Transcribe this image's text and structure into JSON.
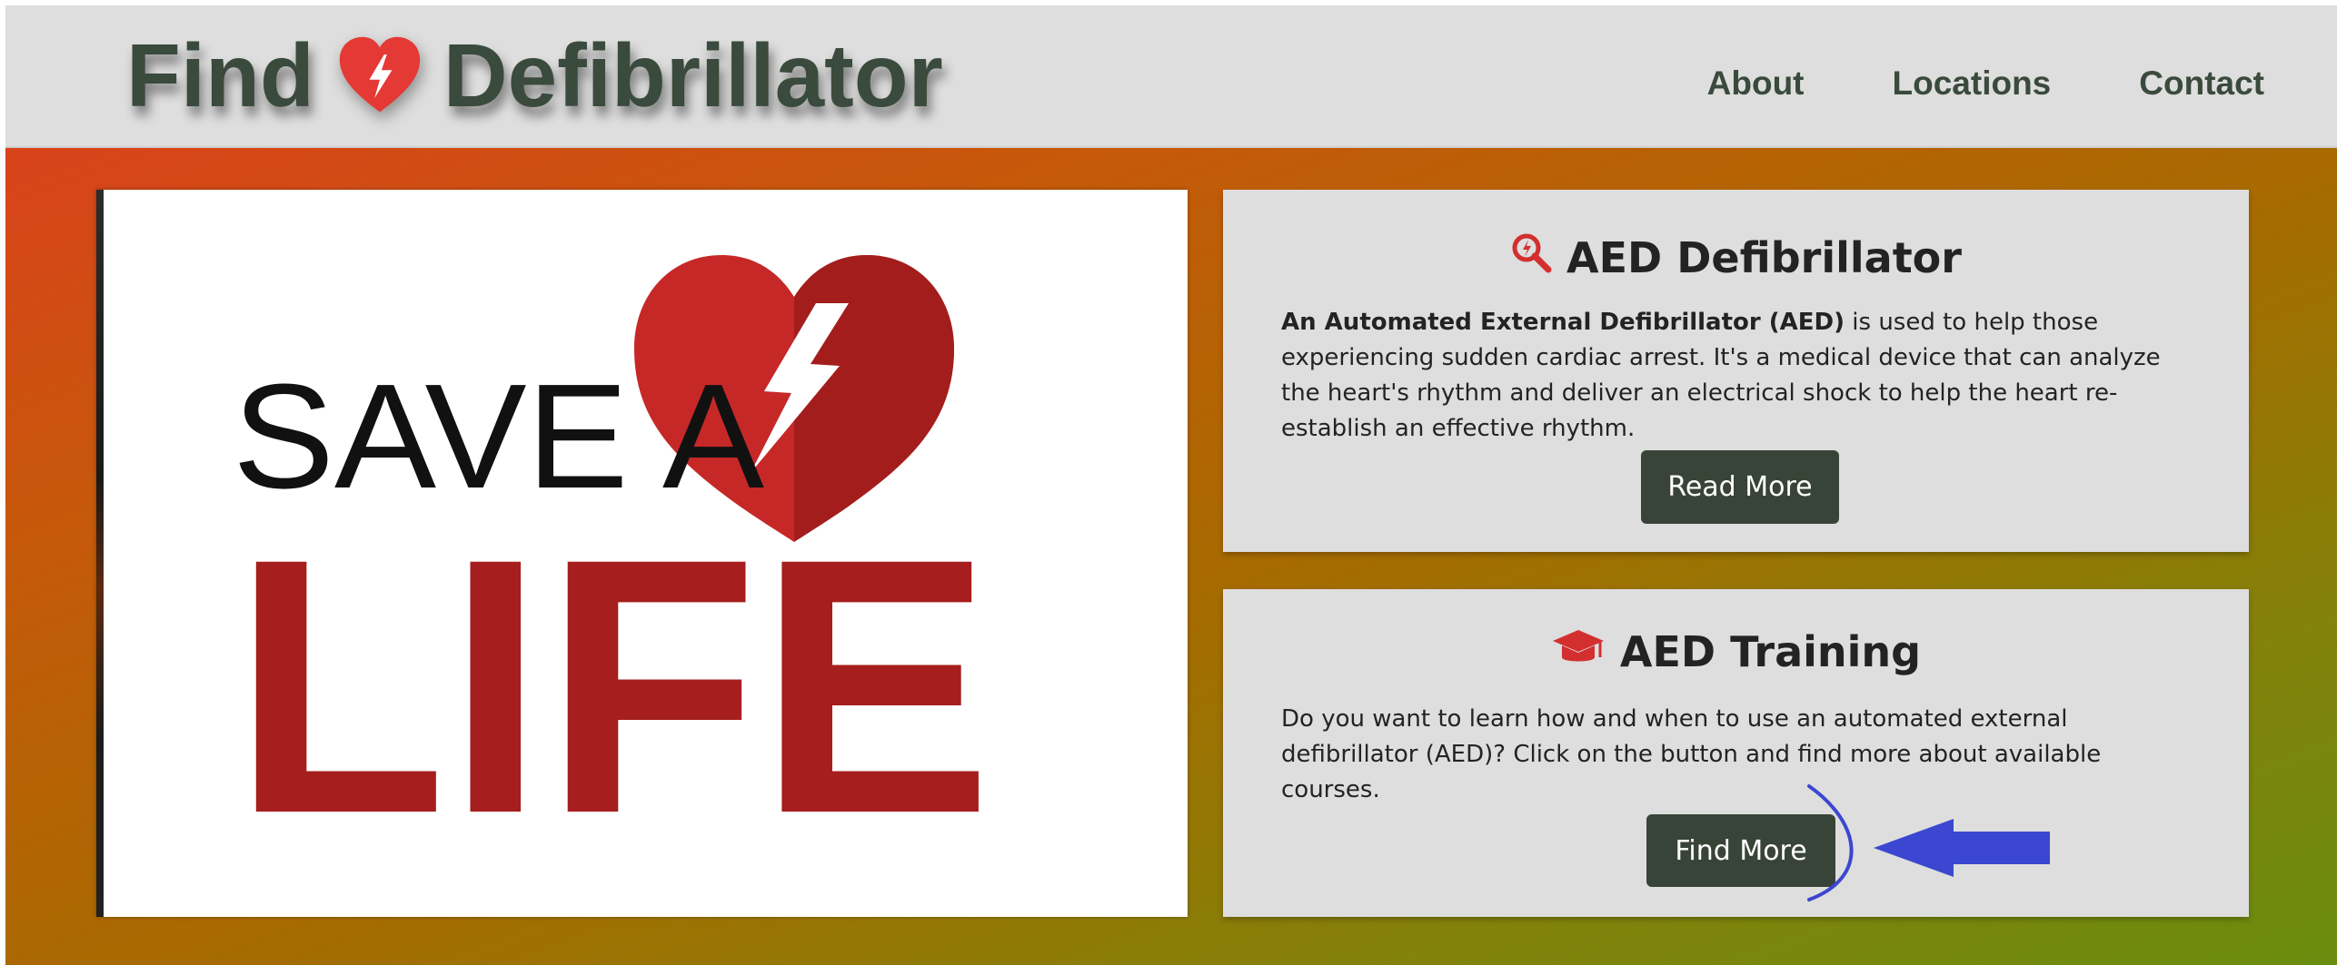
{
  "header": {
    "brand_left": "Find",
    "brand_right": "Defibrillator",
    "brand_icon": "heart-bolt-icon"
  },
  "nav": {
    "items": [
      {
        "label": "About"
      },
      {
        "label": "Locations"
      },
      {
        "label": "Contact"
      }
    ]
  },
  "hero": {
    "line1": "SAVE A",
    "line2": "LIFE",
    "icon": "heart-bolt-icon"
  },
  "cards": [
    {
      "icon": "search-icon",
      "title": "AED Defibrillator",
      "body_bold": "An Automated External Defibrillator (AED)",
      "body_rest": " is used to help those experiencing sudden cardiac arrest. It's a medical device that can analyze the heart's rhythm and deliver an electrical shock to help the heart re-establish an effective rhythm.",
      "button": "Read More"
    },
    {
      "icon": "graduation-cap-icon",
      "title": "AED Training",
      "body": "Do you want to learn how and when to use an automated external defibrillator (AED)? Click on the button and find more about available courses.",
      "button": "Find More"
    }
  ],
  "colors": {
    "accent_red": "#d32f2f",
    "button": "#384437",
    "nav_text": "#3a4a3d",
    "arrow": "#3b47d0"
  }
}
